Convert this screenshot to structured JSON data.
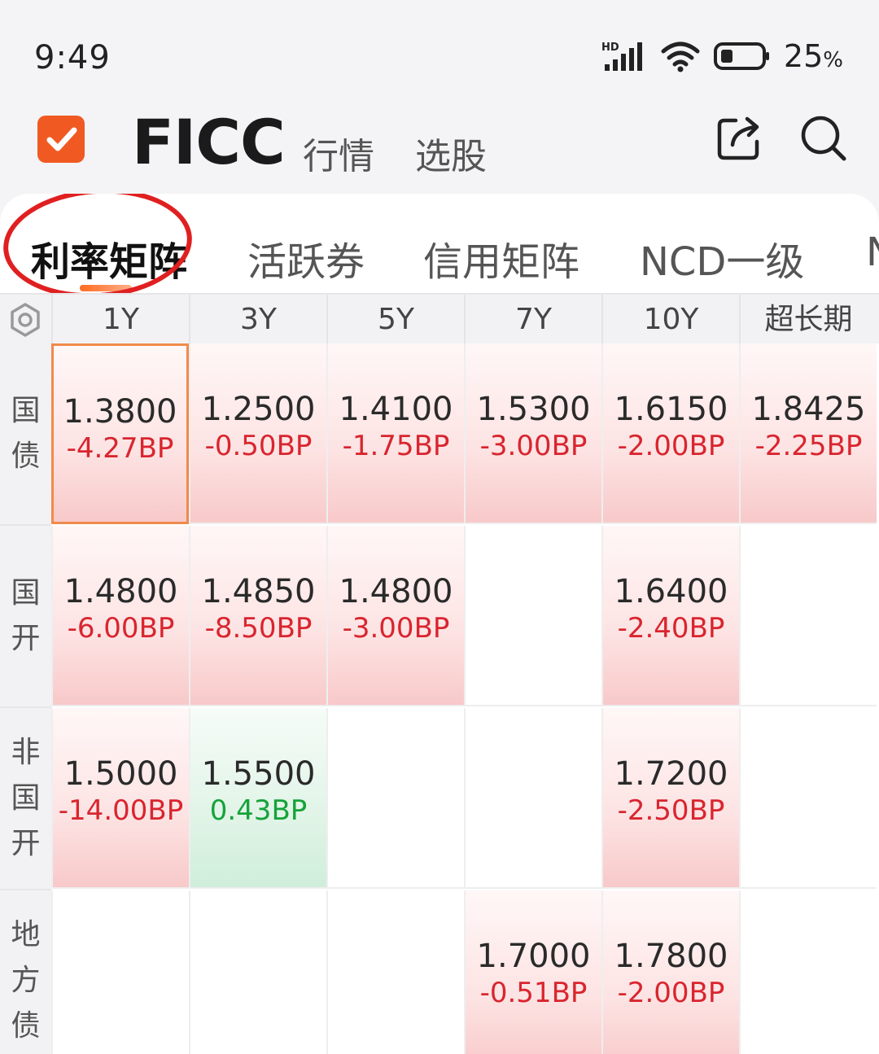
{
  "status_bar": {
    "time": "9:49",
    "battery": "25",
    "battery_unit": "%"
  },
  "header": {
    "title": "FICC",
    "nav": [
      "行情",
      "选股"
    ]
  },
  "tabs": [
    "利率矩阵",
    "活跃券",
    "信用矩阵",
    "NCD一级",
    "N"
  ],
  "active_tab": 0,
  "columns": [
    "1Y",
    "3Y",
    "5Y",
    "7Y",
    "10Y",
    "超长期"
  ],
  "rows": [
    {
      "label": "国债",
      "cells": [
        {
          "value": "1.3800",
          "change": "-4.27BP",
          "dir": "down"
        },
        {
          "value": "1.2500",
          "change": "-0.50BP",
          "dir": "down"
        },
        {
          "value": "1.4100",
          "change": "-1.75BP",
          "dir": "down"
        },
        {
          "value": "1.5300",
          "change": "-3.00BP",
          "dir": "down"
        },
        {
          "value": "1.6150",
          "change": "-2.00BP",
          "dir": "down"
        },
        {
          "value": "1.8425",
          "change": "-2.25BP",
          "dir": "down"
        }
      ]
    },
    {
      "label": "国开",
      "cells": [
        {
          "value": "1.4800",
          "change": "-6.00BP",
          "dir": "down"
        },
        {
          "value": "1.4850",
          "change": "-8.50BP",
          "dir": "down"
        },
        {
          "value": "1.4800",
          "change": "-3.00BP",
          "dir": "down"
        },
        null,
        {
          "value": "1.6400",
          "change": "-2.40BP",
          "dir": "down"
        },
        null
      ]
    },
    {
      "label": "非国开",
      "cells": [
        {
          "value": "1.5000",
          "change": "-14.00BP",
          "dir": "down"
        },
        {
          "value": "1.5500",
          "change": "0.43BP",
          "dir": "up"
        },
        null,
        null,
        {
          "value": "1.7200",
          "change": "-2.50BP",
          "dir": "down"
        },
        null
      ]
    },
    {
      "label": "地方债",
      "cells": [
        null,
        null,
        null,
        {
          "value": "1.7000",
          "change": "-0.51BP",
          "dir": "down"
        },
        {
          "value": "1.7800",
          "change": "-2.00BP",
          "dir": "down"
        },
        null
      ]
    }
  ],
  "colors": {
    "accent": "#f05a22",
    "down": "#d9252f",
    "up": "#15a33a",
    "annotation": "#e02020"
  }
}
